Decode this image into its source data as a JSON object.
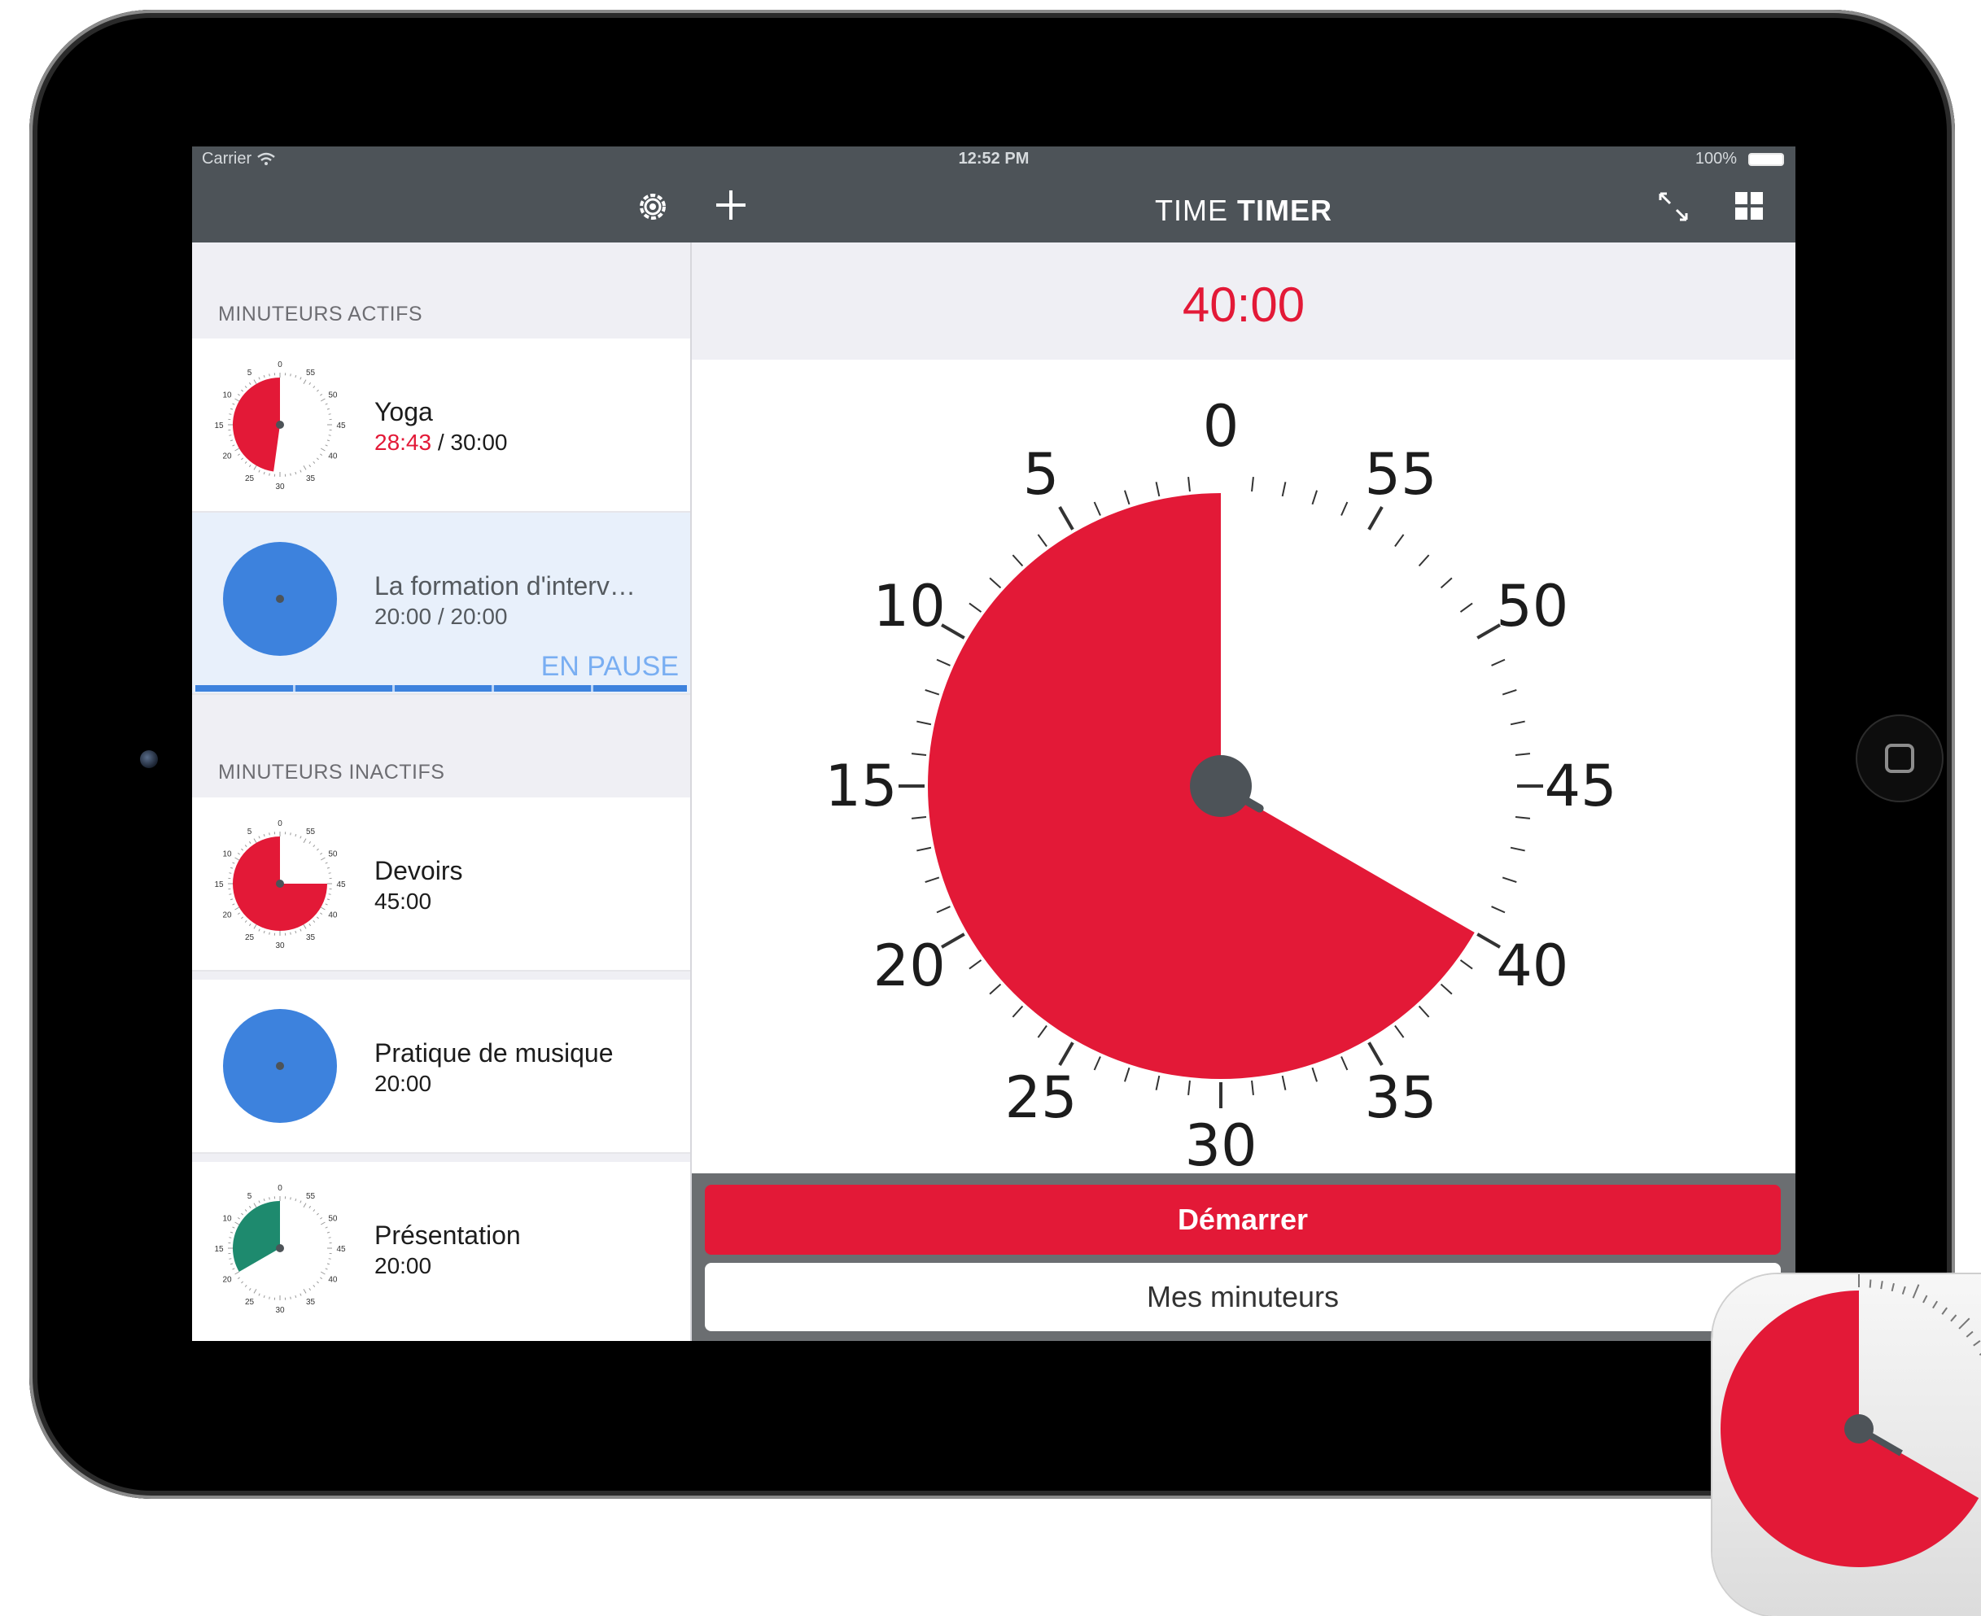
{
  "status_bar": {
    "carrier": "Carrier",
    "time": "12:52 PM",
    "battery": "100%"
  },
  "sidebar": {
    "active_section": "MINUTEURS ACTIFS",
    "inactive_section": "MINUTEURS INACTIFS",
    "active_timers": [
      {
        "name": "Yoga",
        "elapsed": "28:43",
        "separator": " / ",
        "total": "30:00",
        "color": "#e31937",
        "fraction": 0.4783,
        "style": "clock"
      },
      {
        "name": "La formation d'interv…",
        "progress": "20:00 / 20:00",
        "status": "EN PAUSE",
        "color": "#3d82dd",
        "fraction": 1.0,
        "style": "disc"
      }
    ],
    "inactive_timers": [
      {
        "name": "Devoirs",
        "duration": "45:00",
        "color": "#e31937",
        "fraction": 0.75,
        "style": "clock"
      },
      {
        "name": "Pratique de musique",
        "duration": "20:00",
        "color": "#3d82dd",
        "fraction": 1.0,
        "style": "disc"
      },
      {
        "name": "Présentation",
        "duration": "20:00",
        "color": "#1e8a6e",
        "fraction": 0.3333,
        "style": "clock"
      }
    ]
  },
  "header": {
    "title_light": "TIME ",
    "title_bold": "TIMER"
  },
  "timer": {
    "display": "40:00",
    "minutes": 40,
    "color": "#e31937",
    "dial_labels": [
      "0",
      "5",
      "10",
      "15",
      "20",
      "25",
      "30",
      "35",
      "40",
      "45",
      "50",
      "55"
    ]
  },
  "buttons": {
    "start": "Démarrer",
    "my_timers": "Mes minuteurs"
  },
  "icons": [
    "settings-icon",
    "plus-icon",
    "expand-icon",
    "grid-icon",
    "wifi-icon",
    "battery-icon"
  ]
}
